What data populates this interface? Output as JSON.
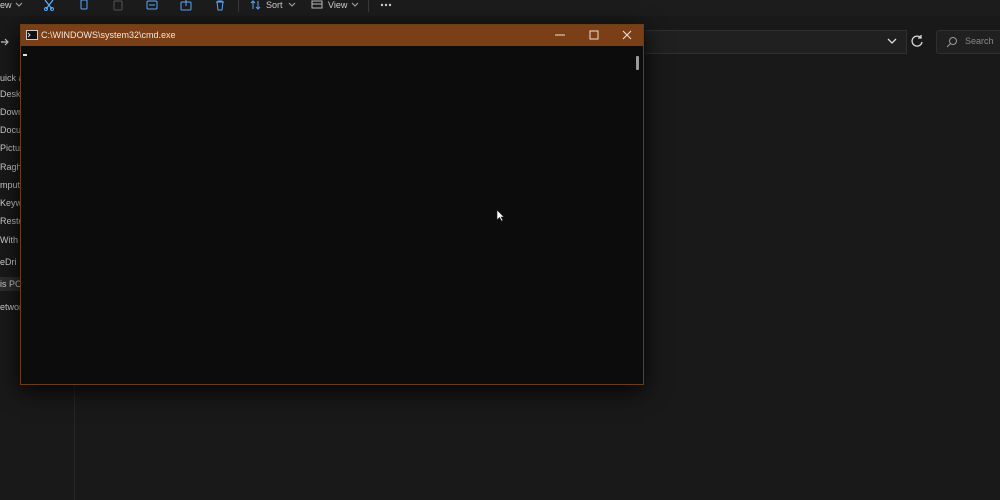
{
  "toolbar": {
    "view_truncated": "ew",
    "sort_label": "Sort",
    "view_label": "View"
  },
  "search": {
    "placeholder": "Search"
  },
  "sidebar": {
    "items": [
      {
        "label": "uick a"
      },
      {
        "label": "Deskt"
      },
      {
        "label": "Down"
      },
      {
        "label": "Docu"
      },
      {
        "label": "Pictur"
      },
      {
        "label": "Ragh"
      },
      {
        "label": "mputi"
      },
      {
        "label": "Keyw"
      },
      {
        "label": "Resto"
      },
      {
        "label": "With I"
      },
      {
        "label": "eDri"
      },
      {
        "label": "is PC"
      },
      {
        "label": "etwor"
      }
    ]
  },
  "cmd": {
    "title": "C:\\WINDOWS\\system32\\cmd.exe"
  },
  "colors": {
    "titlebar": "#7a3f16",
    "console_bg": "#0c0c0c",
    "explorer_bg": "#191919"
  }
}
